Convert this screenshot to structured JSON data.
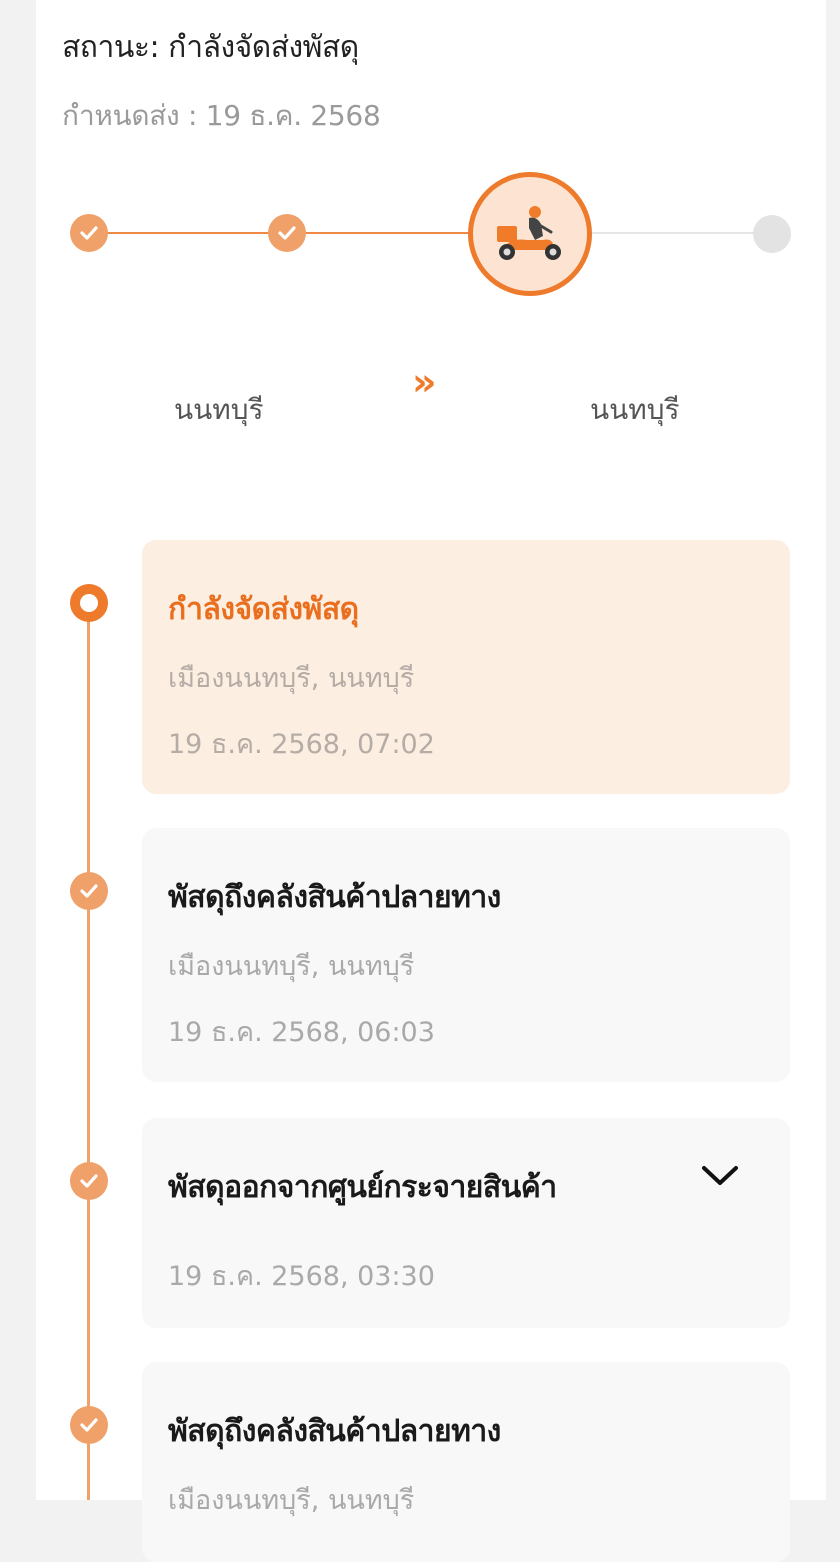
{
  "header": {
    "status": "สถานะ: กำลังจัดส่งพัสดุ",
    "due_date": "กำหนดส่ง : 19 ธ.ค. 2568"
  },
  "progress": {
    "steps_done": 2,
    "steps_total": 4,
    "current_icon": "delivery-scooter-icon"
  },
  "route": {
    "from": "นนทบุรี",
    "arrow": "»",
    "to": "นนทบุรี"
  },
  "colors": {
    "accent": "#ee7a2c",
    "accent_light": "#f0a069",
    "active_bg": "#fdeee2",
    "card_bg": "#f8f8f8"
  },
  "events": [
    {
      "title": "กำลังจัดส่งพัสดุ",
      "location": "เมืองนนทบุรี, นนทบุรี",
      "time": "19 ธ.ค. 2568, 07:02"
    },
    {
      "title": "พัสดุถึงคลังสินค้าปลายทาง",
      "location": "เมืองนนทบุรี, นนทบุรี",
      "time": "19 ธ.ค. 2568, 06:03"
    },
    {
      "title": "พัสดุออกจากศูนย์กระจายสินค้า",
      "time": "19 ธ.ค. 2568, 03:30"
    },
    {
      "title": "พัสดุถึงคลังสินค้าปลายทาง",
      "location": "เมืองนนทบุรี, นนทบุรี"
    }
  ]
}
